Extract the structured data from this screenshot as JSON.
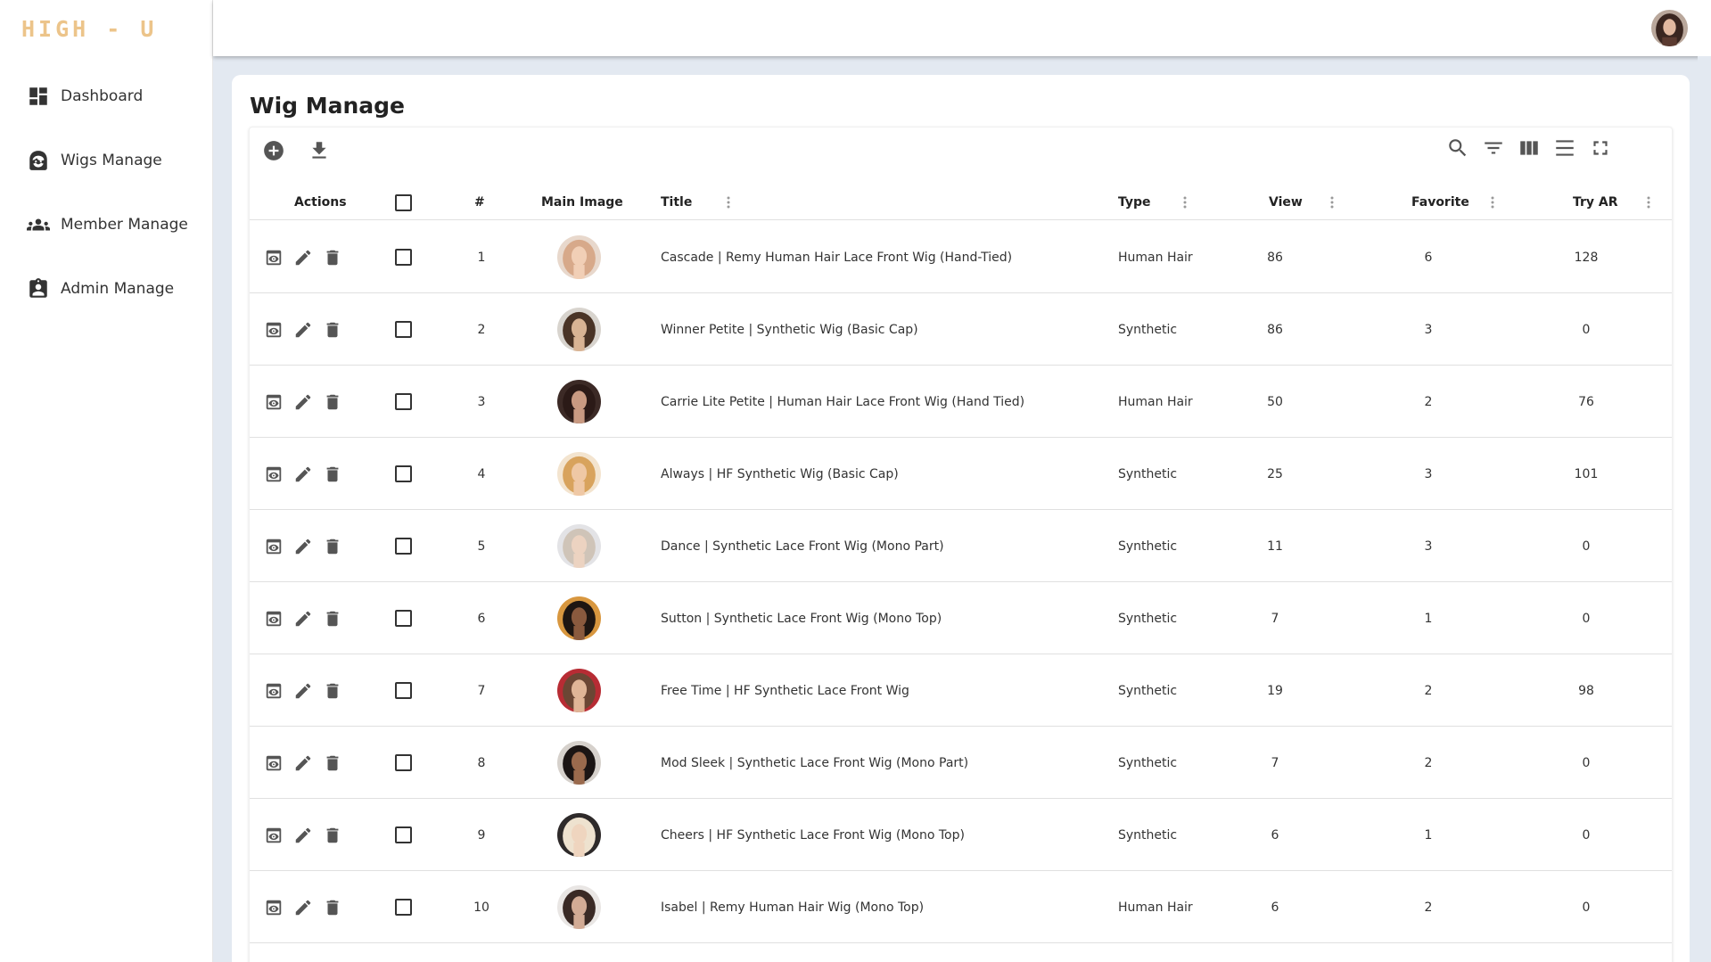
{
  "brand": "HIGH - U",
  "nav": [
    {
      "label": "Dashboard",
      "icon": "dashboard-icon"
    },
    {
      "label": "Wigs Manage",
      "icon": "wig-face-icon"
    },
    {
      "label": "Member Manage",
      "icon": "group-icon"
    },
    {
      "label": "Admin Manage",
      "icon": "admin-badge-icon"
    }
  ],
  "page_title": "Wig Manage",
  "toolbar": {
    "left": [
      "add-circle-icon",
      "download-icon"
    ],
    "right": [
      "search-icon",
      "filter-icon",
      "columns-icon",
      "density-icon",
      "fullscreen-icon"
    ]
  },
  "columns": {
    "actions": "Actions",
    "index": "#",
    "image": "Main Image",
    "title": "Title",
    "type": "Type",
    "view": "View",
    "favorite": "Favorite",
    "try_ar": "Try AR"
  },
  "rows": [
    {
      "index": "1",
      "title": "Cascade | Remy Human Hair Lace Front Wig (Hand-Tied)",
      "type": "Human Hair",
      "view": "86",
      "favorite": "6",
      "try_ar": "128",
      "hair": "#d7a98a",
      "skin": "#f1cfb6",
      "bg": "#e8d8cc"
    },
    {
      "index": "2",
      "title": "Winner Petite | Synthetic Wig (Basic Cap)",
      "type": "Synthetic",
      "view": "86",
      "favorite": "3",
      "try_ar": "0",
      "hair": "#4a3426",
      "skin": "#d9b494",
      "bg": "#d8d4ce"
    },
    {
      "index": "3",
      "title": "Carrie Lite Petite | Human Hair Lace Front Wig (Hand Tied)",
      "type": "Human Hair",
      "view": "50",
      "favorite": "2",
      "try_ar": "76",
      "hair": "#2b1a17",
      "skin": "#c99a82",
      "bg": "#3c2a26"
    },
    {
      "index": "4",
      "title": "Always | HF Synthetic Wig (Basic Cap)",
      "type": "Synthetic",
      "view": "25",
      "favorite": "3",
      "try_ar": "101",
      "hair": "#d8a35d",
      "skin": "#efc8a5",
      "bg": "#f3e4cf"
    },
    {
      "index": "5",
      "title": "Dance | Synthetic Lace Front Wig (Mono Part)",
      "type": "Synthetic",
      "view": "11",
      "favorite": "3",
      "try_ar": "0",
      "hair": "#cfc4b8",
      "skin": "#ecd3c1",
      "bg": "#e3e3e6"
    },
    {
      "index": "6",
      "title": "Sutton | Synthetic Lace Front Wig (Mono Top)",
      "type": "Synthetic",
      "view": "7",
      "favorite": "1",
      "try_ar": "0",
      "hair": "#1e1612",
      "skin": "#8a5a3e",
      "bg": "#d8973f"
    },
    {
      "index": "7",
      "title": "Free Time | HF Synthetic Lace Front Wig",
      "type": "Synthetic",
      "view": "19",
      "favorite": "2",
      "try_ar": "98",
      "hair": "#6b4634",
      "skin": "#e0b597",
      "bg": "#b72c34"
    },
    {
      "index": "8",
      "title": "Mod Sleek | Synthetic Lace Front Wig (Mono Part)",
      "type": "Synthetic",
      "view": "7",
      "favorite": "2",
      "try_ar": "0",
      "hair": "#1b1514",
      "skin": "#9a6a4d",
      "bg": "#d6d1cc"
    },
    {
      "index": "9",
      "title": "Cheers | HF Synthetic Lace Front Wig (Mono Top)",
      "type": "Synthetic",
      "view": "6",
      "favorite": "1",
      "try_ar": "0",
      "hair": "#eee2cf",
      "skin": "#efd5bf",
      "bg": "#2e2a2a"
    },
    {
      "index": "10",
      "title": "Isabel | Remy Human Hair Wig (Mono Top)",
      "type": "Human Hair",
      "view": "6",
      "favorite": "2",
      "try_ar": "0",
      "hair": "#3a2a25",
      "skin": "#d2ab95",
      "bg": "#e9e6e4"
    }
  ],
  "colors": {
    "brand": "#ecc48a",
    "background": "#e3e9f1",
    "icon": "#555555"
  }
}
